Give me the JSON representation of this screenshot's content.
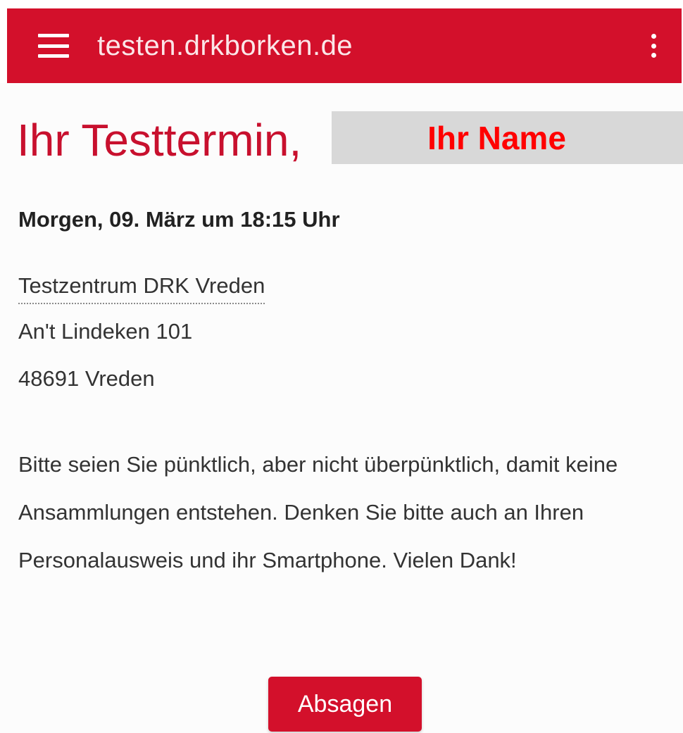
{
  "app_bar": {
    "title": "testen.drkborken.de",
    "menu_icon": "hamburger-menu-icon",
    "more_icon": "more-vertical-icon",
    "background": "#d3102b"
  },
  "page": {
    "title": "Ihr Testtermin,",
    "name_placeholder": "Ihr Name"
  },
  "appointment": {
    "date": "Morgen, 09. März um 18:15 Uhr",
    "location_name": "Testzentrum DRK Vreden",
    "street": "An't Lindeken 101",
    "city": "48691 Vreden"
  },
  "notice": "Bitte seien Sie pünktlich, aber nicht überpünktlich, damit keine Ansammlungen entstehen. Denken Sie bitte auch an Ihren Personalausweis und ihr Smartphone. Vielen Dank!",
  "actions": {
    "cancel_label": "Absagen"
  },
  "colors": {
    "accent": "#c8102e",
    "name_text": "#ff0000",
    "name_box": "#d8d8d8"
  }
}
